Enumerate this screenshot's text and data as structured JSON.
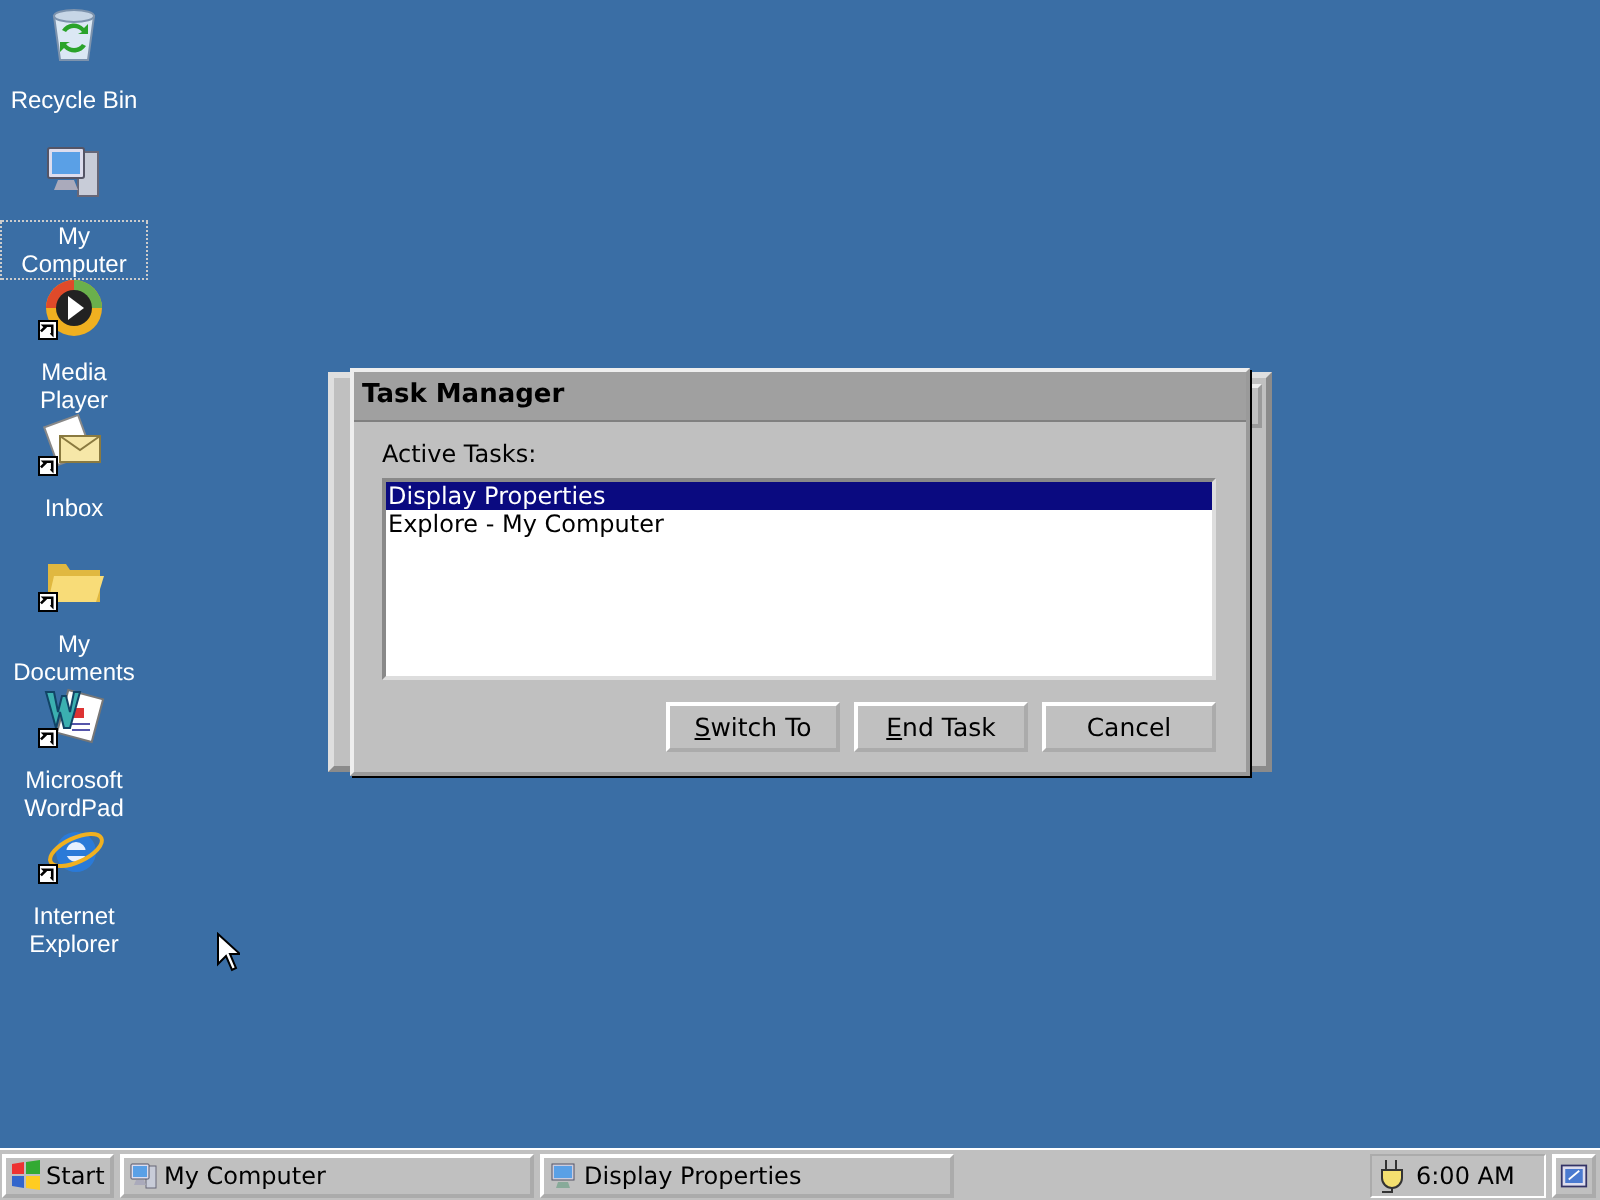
{
  "desktop_icons": [
    {
      "kind": "recycle-bin",
      "label": "Recycle Bin",
      "shortcut": false,
      "selected": false
    },
    {
      "kind": "computer",
      "label": "My Computer",
      "shortcut": false,
      "selected": true
    },
    {
      "kind": "media-player",
      "label": "Media Player",
      "shortcut": true,
      "selected": false
    },
    {
      "kind": "inbox",
      "label": "Inbox",
      "shortcut": true,
      "selected": false
    },
    {
      "kind": "folder",
      "label": "My Documents",
      "shortcut": true,
      "selected": false
    },
    {
      "kind": "wordpad",
      "label": "Microsoft WordPad",
      "shortcut": true,
      "selected": false
    },
    {
      "kind": "browser",
      "label": "Internet Explorer",
      "shortcut": true,
      "selected": false
    }
  ],
  "dialog": {
    "title": "Task Manager",
    "list_label": "Active Tasks:",
    "tasks": [
      {
        "label": "Display Properties",
        "selected": true
      },
      {
        "label": "Explore - My Computer",
        "selected": false
      }
    ],
    "buttons": [
      {
        "label": "Switch To",
        "mnemonic_underlined": true
      },
      {
        "label": "End Task",
        "mnemonic_underlined": true
      },
      {
        "label": "Cancel",
        "mnemonic_underlined": false
      }
    ]
  },
  "taskbar": {
    "start": "Start",
    "windows": [
      {
        "label": "My Computer",
        "kind": "computer",
        "selected": false
      },
      {
        "label": "Display Properties",
        "kind": "display",
        "selected": false
      }
    ],
    "clock": "6:00 AM"
  }
}
